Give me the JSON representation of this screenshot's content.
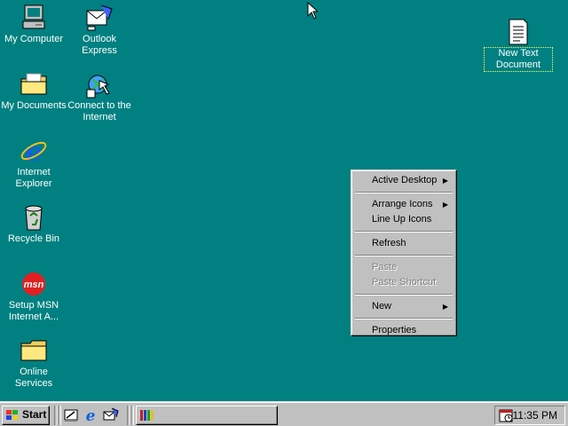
{
  "desktop": {
    "icons": [
      {
        "label": "My Computer"
      },
      {
        "label": "Outlook Express"
      },
      {
        "label": "My Documents"
      },
      {
        "label": "Connect to the Internet"
      },
      {
        "label": "Internet Explorer"
      },
      {
        "label": "Recycle Bin"
      },
      {
        "label": "Setup MSN Internet A..."
      },
      {
        "label": "Online Services"
      },
      {
        "label": "New Text Document"
      }
    ],
    "background_color": "#008080"
  },
  "context_menu": {
    "items": [
      {
        "label": "Active Desktop",
        "submenu": true,
        "enabled": true
      },
      {
        "label": "Arrange Icons",
        "submenu": true,
        "enabled": true
      },
      {
        "label": "Line Up Icons",
        "submenu": false,
        "enabled": true
      },
      {
        "label": "Refresh",
        "submenu": false,
        "enabled": true
      },
      {
        "label": "Paste",
        "submenu": false,
        "enabled": false
      },
      {
        "label": "Paste Shortcut",
        "submenu": false,
        "enabled": false
      },
      {
        "label": "New",
        "submenu": true,
        "enabled": true
      },
      {
        "label": "Properties",
        "submenu": false,
        "enabled": true
      }
    ]
  },
  "taskbar": {
    "start_label": "Start",
    "quick_launch": [
      "show-desktop-icon",
      "internet-explorer-icon",
      "outlook-express-icon",
      "channels-icon"
    ],
    "clock": "11:35 PM"
  },
  "icons": {
    "arrow_glyph": "▶"
  }
}
